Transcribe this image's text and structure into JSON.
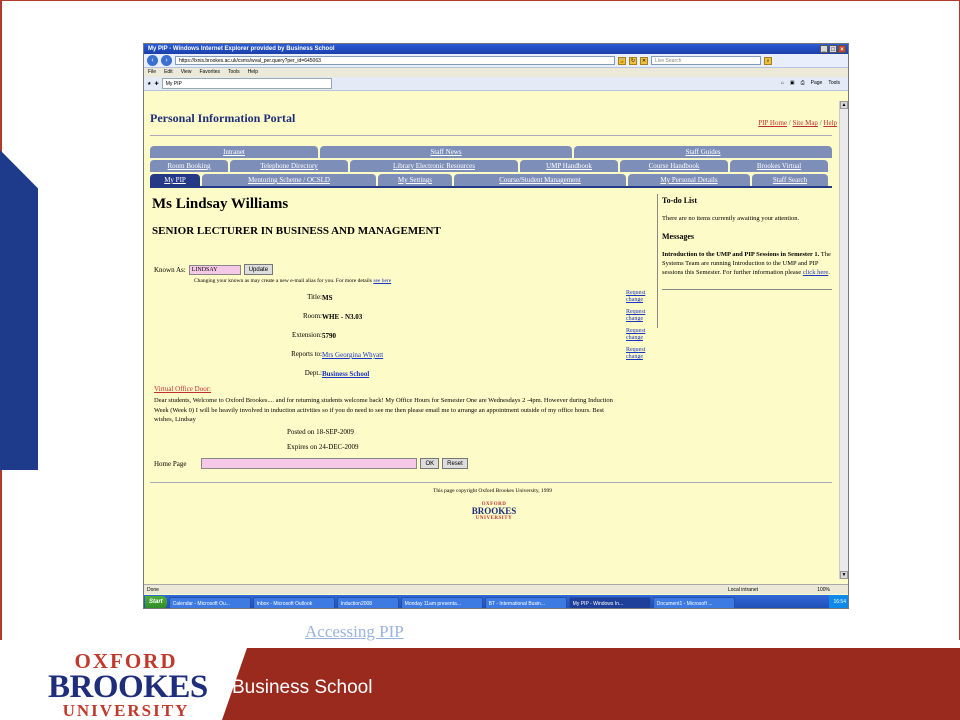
{
  "browser": {
    "window_title": "My PIP - Windows Internet Explorer provided by Business School",
    "url": "https://lxnis.brookes.ac.uk/csms/wval_per.query?per_id=645063",
    "search_placeholder": "Live Search",
    "menu": [
      "File",
      "Edit",
      "View",
      "Favorites",
      "Tools",
      "Help"
    ],
    "tab_label": "My PIP",
    "toolbar": [
      "Page",
      "Tools"
    ],
    "status": "Done",
    "zone": "Local intranet",
    "zoom": "100%"
  },
  "portal": {
    "title": "Personal Information Portal",
    "top_links": [
      "PIP Home",
      "Site Map",
      "Help"
    ],
    "tabs_row1": [
      "Intranet",
      "Staff News",
      "Staff Guides"
    ],
    "tabs_row2": [
      "Room Booking",
      "Telephone Directory",
      "Library Electronic Resources",
      "UMP Handbook",
      "Course Handbook",
      "Brookes Virtual"
    ],
    "tabs_row3": [
      "My PIP",
      "Mentoring Scheme / OCSLD",
      "My Settings",
      "Course/Student Management",
      "My Personal Details",
      "Staff Search"
    ]
  },
  "profile": {
    "name": "Ms Lindsay Williams",
    "role": "SENIOR LECTURER IN BUSINESS AND MANAGEMENT",
    "known_as_label": "Known As:",
    "known_as_value": "LINDSAY",
    "update_label": "Update",
    "alias_note": "Changing your known as may create a new e-mail alias for you. For more details",
    "alias_link": "see here",
    "fields": [
      {
        "label": "Title:",
        "value": "MS",
        "request": "Request change"
      },
      {
        "label": "Room:",
        "value": "WHE - N3.03",
        "request": "Request change"
      },
      {
        "label": "Extension:",
        "value": "5790",
        "request": "Request change"
      },
      {
        "label": "Reports to:",
        "value": "Mrs Georgina Whyatt",
        "request": "Request change"
      },
      {
        "label": "Dept.:",
        "value": "Business School",
        "request": ""
      }
    ],
    "vod_label": "Virtual Office Door:",
    "vod_text": "Dear students, Welcome to Oxford Brookes.... and for returning students welcome back! My Office Hours for Semester One are Wednesdays 2 -4pm. However during Induction Week (Week 0) I will be heavily involved in induction activities so if you do need to see me then please email me to arrange an appointment outside of my office hours. Best wishes, Lindsay",
    "posted": "Posted on 18-SEP-2009",
    "expires": "Expires on 24-DEC-2009",
    "home_page_label": "Home Page",
    "ok_label": "OK",
    "reset_label": "Reset"
  },
  "sidebar": {
    "todo_title": "To-do List",
    "todo_text": "There are no items currently awaiting your attention.",
    "messages_title": "Messages",
    "message_head": "Introduction to the UMP and PIP Sessions in Semester 1.",
    "message_body": "The Systems Team are running Introduction to the UMP and PIP sessions this Semester. For further information please",
    "message_link": "click here"
  },
  "footer": {
    "copyright": "This page copyright Oxford Brookes University, 1999",
    "logo_top": "OXFORD",
    "logo_mid": "BROOKES",
    "logo_bottom": "UNIVERSITY"
  },
  "taskbar": {
    "start": "Start",
    "tasks": [
      "Calendar - Microsoft Ou...",
      "Inbox - Microsoft Outlook",
      "Induction2008",
      "Monday 11am presenta...",
      "BT - International Busin...",
      "My PIP - Windows In...",
      "Document1 - Microsoft ..."
    ],
    "clock": "16:54"
  },
  "slide": {
    "caption": "Accessing PIP",
    "band_label": "Business School",
    "logo_top": "OXFORD",
    "logo_mid": "BROOKES",
    "logo_bottom": "UNIVERSITY"
  },
  "colors": {
    "brand_red": "#9b2a1e",
    "brand_blue": "#1e2e7a",
    "page_bg": "#fdfbc8",
    "tab_blue": "#7d8fb8"
  }
}
